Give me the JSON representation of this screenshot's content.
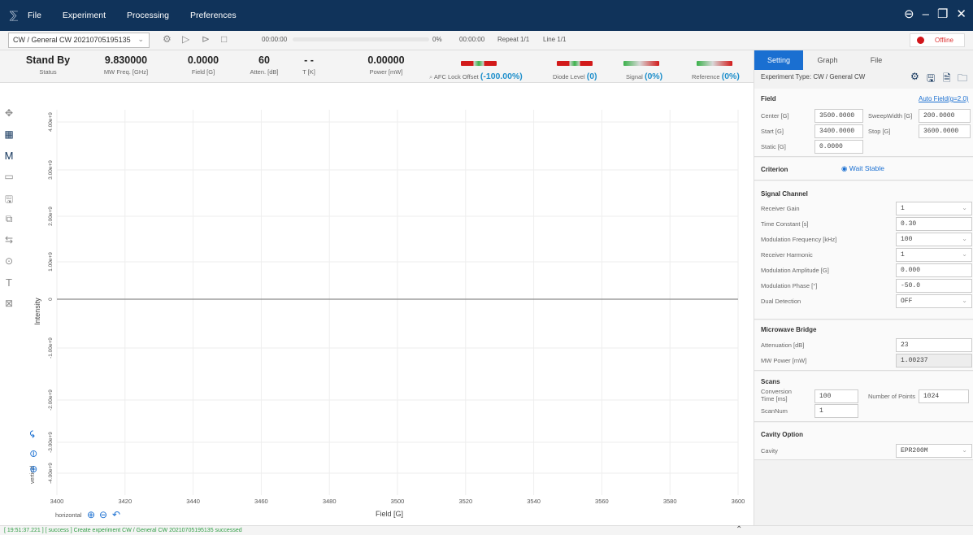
{
  "titlebar": {
    "menu": [
      "File",
      "Experiment",
      "Processing",
      "Preferences"
    ]
  },
  "toolbar": {
    "experiment": "CW / General CW 20210705195135",
    "elapsed": "00:00:00",
    "progress_pct": "0%",
    "remaining": "00:00:00",
    "repeat": "Repeat 1/1",
    "line": "Line 1/1",
    "connection": "Offline"
  },
  "status": {
    "state": {
      "value": "Stand By",
      "label": "Status"
    },
    "mw_freq": {
      "value": "9.830000",
      "label": "MW Freq. [GHz]"
    },
    "field": {
      "value": "0.0000",
      "label": "Field [G]"
    },
    "atten": {
      "value": "60",
      "label": "Atten. [dB]"
    },
    "temp": {
      "value": "- -",
      "label": "T [K]"
    },
    "power": {
      "value": "0.00000",
      "label": "Power [mW]"
    },
    "afc": {
      "label": "AFC Lock Offset",
      "value": "(-100.00%)"
    },
    "diode": {
      "label": "Diode Level",
      "value": "(0)"
    },
    "signal": {
      "label": "Signal",
      "value": "(0%)"
    },
    "reference": {
      "label": "Reference",
      "value": "(0%)"
    }
  },
  "plot": {
    "ylabel": "Intensity",
    "xlabel": "Field [G]",
    "horizontal_label": "horizontal",
    "vertical_label": "vertical",
    "xticks": [
      "3400",
      "3420",
      "3440",
      "3460",
      "3480",
      "3500",
      "3520",
      "3540",
      "3560",
      "3580",
      "3600"
    ],
    "yticks": [
      "4.00e+9",
      "3.00e+9",
      "2.00e+9",
      "1.00e+9",
      "0",
      "-1.00e+9",
      "-2.00e+9",
      "-3.00e+9",
      "-4.00e+9"
    ]
  },
  "panel": {
    "tabs": [
      "Setting",
      "Graph",
      "File"
    ],
    "experiment_type": "Experiment Type: CW / General CW",
    "field": {
      "title": "Field",
      "auto_field": "Auto Field(g=2.0)",
      "center_label": "Center [G]",
      "center": "3500.0000",
      "sweep_label": "SweepWidth [G]",
      "sweep": "200.0000",
      "start_label": "Start [G]",
      "start": "3400.0000",
      "stop_label": "Stop [G]",
      "stop": "3600.0000",
      "static_label": "Static [G]",
      "static": "0.0000"
    },
    "criterion": {
      "title": "Criterion",
      "option": "Wait Stable"
    },
    "signal": {
      "title": "Signal Channel",
      "rows": [
        {
          "label": "Receiver Gain",
          "value": "1",
          "select": true
        },
        {
          "label": "Time Constant [s]",
          "value": "0.30",
          "select": false
        },
        {
          "label": "Modulation Frequency [kHz]",
          "value": "100",
          "select": true
        },
        {
          "label": "Receiver Harmonic",
          "value": "1",
          "select": true
        },
        {
          "label": "Modulation Amplitude [G]",
          "value": "0.000",
          "select": false
        },
        {
          "label": "Modulation Phase [°]",
          "value": "-50.0",
          "select": false
        },
        {
          "label": "Dual Detection",
          "value": "OFF",
          "select": true
        }
      ]
    },
    "bridge": {
      "title": "Microwave Bridge",
      "atten_label": "Attenuation [dB]",
      "atten": "23",
      "power_label": "MW Power [mW]",
      "power": "1.00237"
    },
    "scans": {
      "title": "Scans",
      "conv_label": "Conversion Time [ms]",
      "conv": "100",
      "points_label": "Number of Points",
      "points": "1024",
      "scannum_label": "ScanNum",
      "scannum": "1"
    },
    "cavity": {
      "title": "Cavity Option",
      "label": "Cavity",
      "value": "EPR200M"
    }
  },
  "log": "[ 19:51:37.221 ] [ success ] Create experiment CW / General CW 20210705195135 successed"
}
